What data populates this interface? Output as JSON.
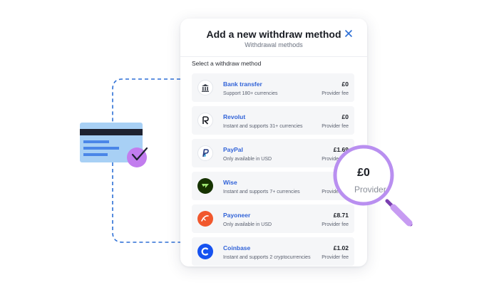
{
  "panel": {
    "title": "Add a new withdraw method",
    "subtitle": "Withdrawal methods",
    "section_label": "Select a withdraw method"
  },
  "methods": [
    {
      "name": "Bank transfer",
      "description": "Support 180+ currencies",
      "fee": "£0",
      "fee_label": "Provider fee",
      "icon": "bank-icon"
    },
    {
      "name": "Revolut",
      "description": "Instant and supports 31+ currencies",
      "fee": "£0",
      "fee_label": "Provider fee",
      "icon": "revolut-icon"
    },
    {
      "name": "PayPal",
      "description": "Only available in USD",
      "fee": "£1.69",
      "fee_label": "Provider fee",
      "icon": "paypal-icon"
    },
    {
      "name": "Wise",
      "description": "Instant and supports 7+ currencies",
      "fee": "£0",
      "fee_label": "Provider fee",
      "icon": "wise-icon"
    },
    {
      "name": "Payoneer",
      "description": "Only available in USD",
      "fee": "£8.71",
      "fee_label": "Provider fee",
      "icon": "payoneer-icon"
    },
    {
      "name": "Coinbase",
      "description": "Instant and supports 2 cryptocurrencies",
      "fee": "£1.02",
      "fee_label": "Provider fee",
      "icon": "coinbase-icon"
    }
  ],
  "magnifier": {
    "value": "£0",
    "label": "Provider fee"
  },
  "colors": {
    "accent_blue": "#3163d8",
    "dashed_line": "#2d6fd6",
    "card": "#a8d0f5",
    "badge_purple": "#c27dee",
    "magnifier_purple": "#b98ff0"
  }
}
